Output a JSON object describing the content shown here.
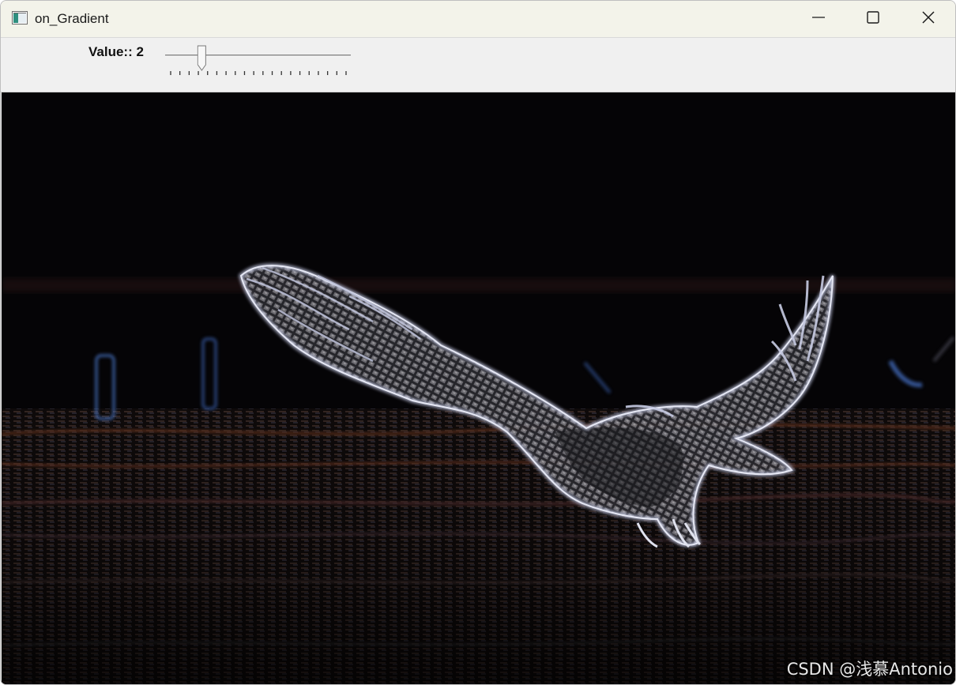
{
  "window": {
    "title": "on_Gradient",
    "controls": [
      "minimize-icon",
      "maximize-icon",
      "close-icon"
    ]
  },
  "trackbar": {
    "label": "Value:: 2",
    "value": 2,
    "tick_count": 20
  },
  "image": {
    "watermark": "CSDN @浅慕Antonio"
  },
  "colors": {
    "titlebar": "#f3f3ea",
    "toolbar": "#f0f0f0",
    "canvas": "#050406",
    "edge_highlight": "#c8cde8"
  }
}
